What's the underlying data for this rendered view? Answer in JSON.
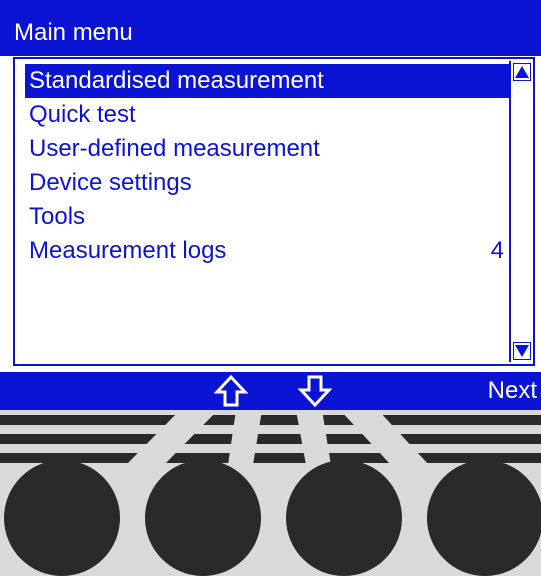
{
  "colors": {
    "accent": "#0b14d2",
    "background": "#ffffff",
    "panel": "#d9d9d9",
    "key": "#2a2a2a"
  },
  "header": {
    "title": "Main menu"
  },
  "menu": {
    "items": [
      {
        "label": "Standardised measurement",
        "count": "",
        "selected": true
      },
      {
        "label": "Quick test",
        "count": ""
      },
      {
        "label": "User-defined measurement",
        "count": ""
      },
      {
        "label": "Device settings",
        "count": ""
      },
      {
        "label": "Tools",
        "count": ""
      },
      {
        "label": "Measurement logs",
        "count": "4"
      }
    ]
  },
  "scrollbar": {
    "up_icon": "triangle-up-icon",
    "down_icon": "triangle-down-icon"
  },
  "softkeys": {
    "up_icon": "arrow-up-icon",
    "down_icon": "arrow-down-icon",
    "next_label": "Next"
  }
}
